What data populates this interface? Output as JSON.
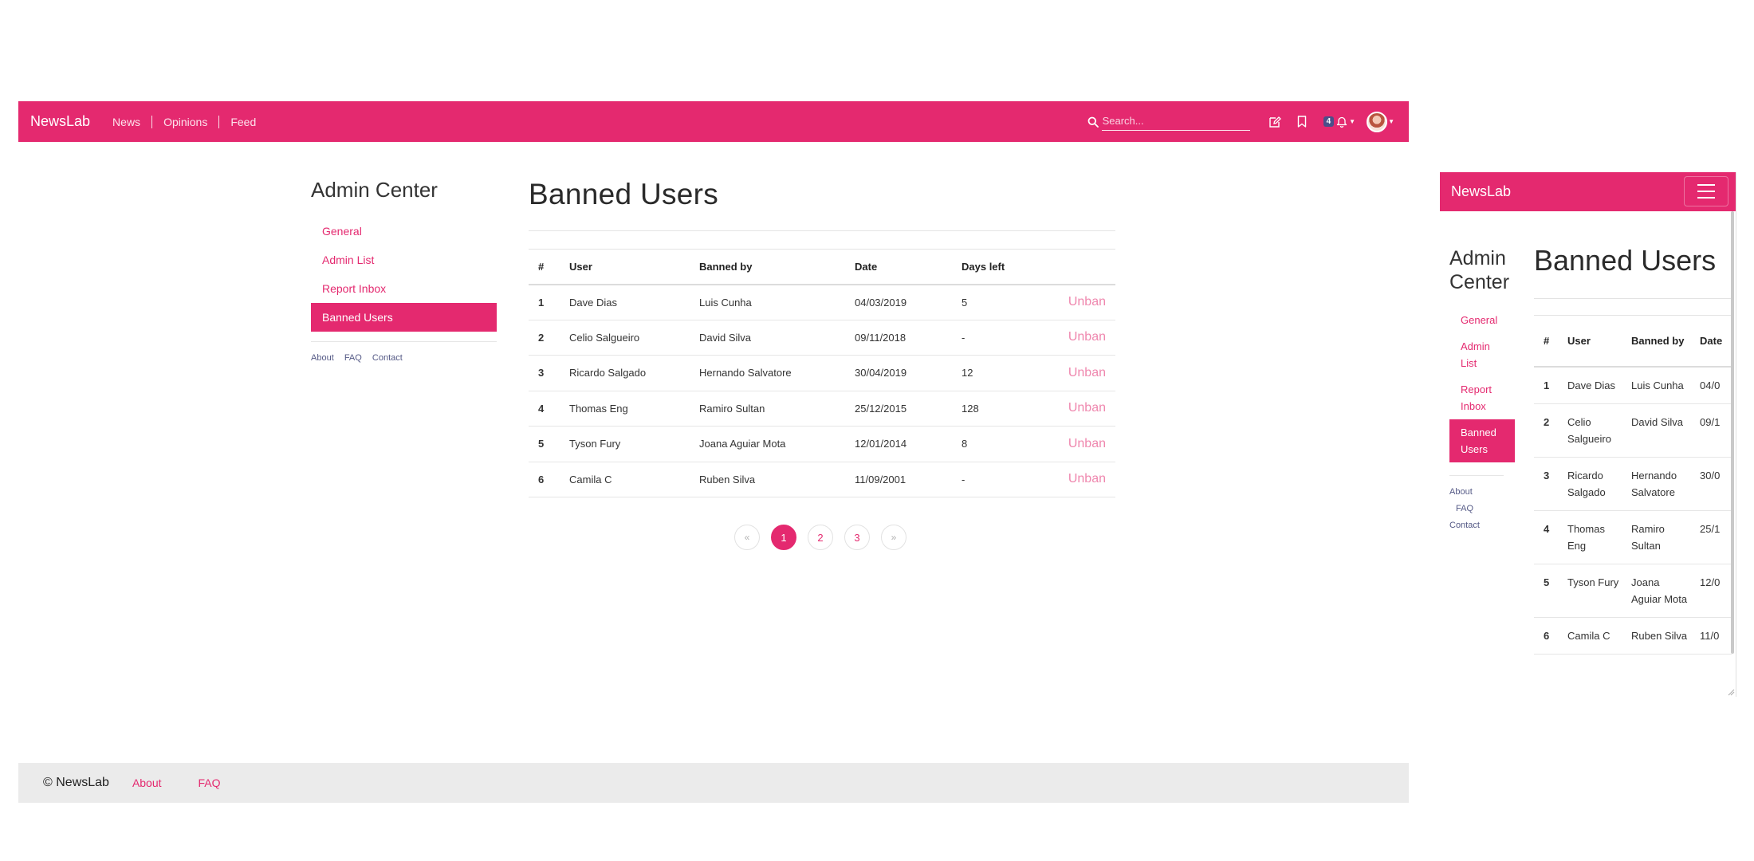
{
  "app": {
    "brand": "NewsLab"
  },
  "nav": {
    "links": [
      "News",
      "Opinions",
      "Feed"
    ],
    "search_placeholder": "Search...",
    "notification_count": "4"
  },
  "sidebar": {
    "title": "Admin Center",
    "items": [
      {
        "label": "General",
        "active": false
      },
      {
        "label": "Admin List",
        "active": false
      },
      {
        "label": "Report Inbox",
        "active": false
      },
      {
        "label": "Banned Users",
        "active": true
      }
    ],
    "footer_links": [
      "About",
      "FAQ",
      "Contact"
    ]
  },
  "page": {
    "title": "Banned Users"
  },
  "table": {
    "headers": [
      "#",
      "User",
      "Banned by",
      "Date",
      "Days left"
    ],
    "action_label": "Unban",
    "rows": [
      {
        "idx": "1",
        "user": "Dave Dias",
        "banned_by": "Luis Cunha",
        "date": "04/03/2019",
        "days_left": "5"
      },
      {
        "idx": "2",
        "user": "Celio Salgueiro",
        "banned_by": "David Silva",
        "date": "09/11/2018",
        "days_left": "-"
      },
      {
        "idx": "3",
        "user": "Ricardo Salgado",
        "banned_by": "Hernando Salvatore",
        "date": "30/04/2019",
        "days_left": "12"
      },
      {
        "idx": "4",
        "user": "Thomas Eng",
        "banned_by": "Ramiro Sultan",
        "date": "25/12/2015",
        "days_left": "128"
      },
      {
        "idx": "5",
        "user": "Tyson Fury",
        "banned_by": "Joana Aguiar Mota",
        "date": "12/01/2014",
        "days_left": "8"
      },
      {
        "idx": "6",
        "user": "Camila C",
        "banned_by": "Ruben Silva",
        "date": "11/09/2001",
        "days_left": "-"
      }
    ]
  },
  "pagination": {
    "prev": "«",
    "pages": [
      "1",
      "2",
      "3"
    ],
    "current": "1",
    "next": "»"
  },
  "footer": {
    "copyright": "© NewsLab",
    "links": [
      "About",
      "FAQ"
    ]
  },
  "mobile": {
    "sidebar_title_lines": [
      "Admin",
      "Center"
    ],
    "headers": [
      "#",
      "User",
      "Banned by",
      "Date"
    ],
    "date_truncated": [
      "04/0",
      "09/1",
      "30/0",
      "25/1",
      "12/0",
      "11/0"
    ]
  },
  "colors": {
    "accent": "#e4296f",
    "unban": "#ef87ae",
    "footer_bg": "#ebebeb",
    "badge": "#4a4f8a"
  }
}
